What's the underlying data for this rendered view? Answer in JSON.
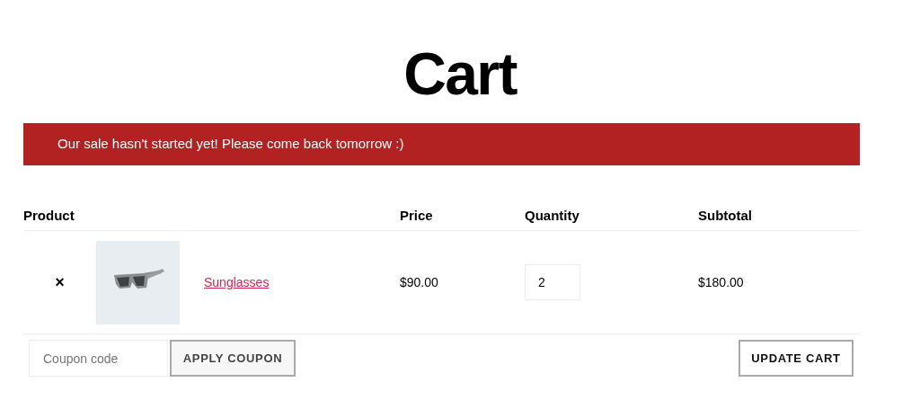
{
  "title": "Cart",
  "notice": "Our sale hasn't started yet! Please come back tomorrow :)",
  "table": {
    "columns": [
      "Product",
      "Price",
      "Quantity",
      "Subtotal"
    ],
    "rows": [
      {
        "remove": "×",
        "product": "Sunglasses",
        "price": "$90.00",
        "quantity": "2",
        "subtotal": "$180.00"
      }
    ]
  },
  "coupon": {
    "placeholder": "Coupon code",
    "button": "APPLY COUPON"
  },
  "update_button": "UPDATE CART"
}
